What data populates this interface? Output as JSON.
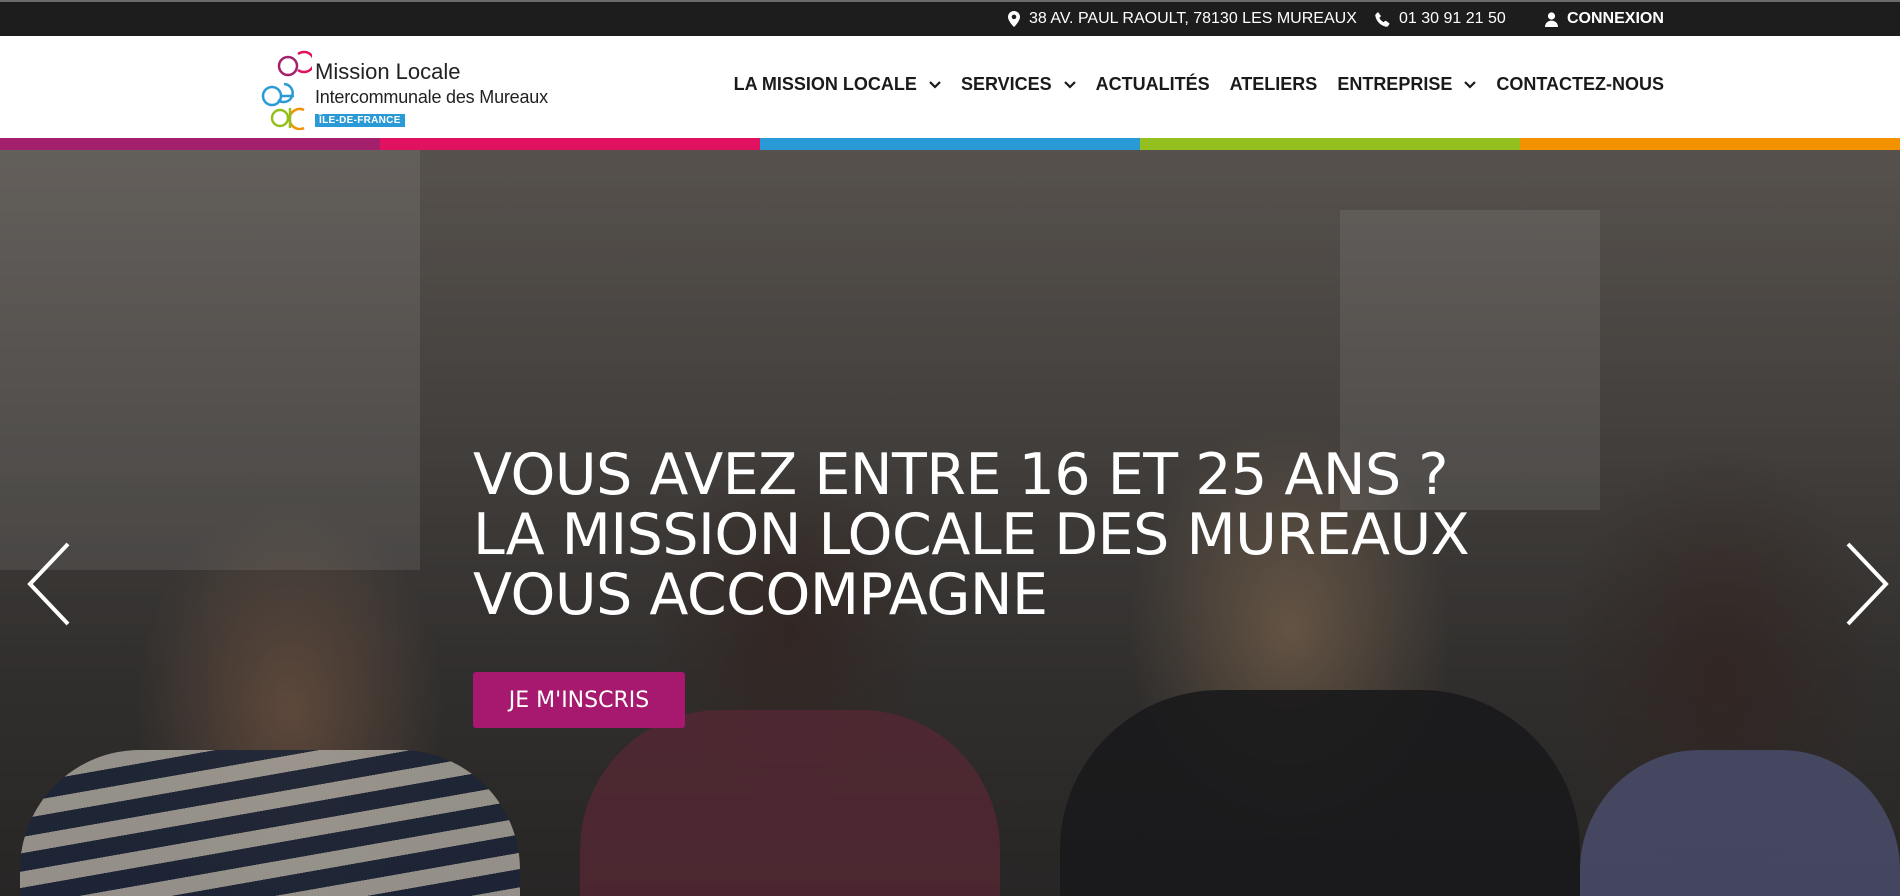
{
  "topbar": {
    "address": "38 AV. PAUL RAOULT, 78130 LES MUREAUX",
    "phone": "01 30 91 21 50",
    "login": "CONNEXION",
    "icons": [
      "location-pin-icon",
      "phone-icon",
      "user-icon"
    ]
  },
  "logo": {
    "title": "Mission Locale",
    "subtitle": "Intercommunale des Mureaux",
    "badge": "ÎLE-DE-FRANCE"
  },
  "nav": {
    "items": [
      {
        "label": "LA MISSION LOCALE",
        "has_dropdown": true
      },
      {
        "label": "SERVICES",
        "has_dropdown": true
      },
      {
        "label": "ACTUALITÉS",
        "has_dropdown": false
      },
      {
        "label": "ATELIERS",
        "has_dropdown": false
      },
      {
        "label": "ENTREPRISE",
        "has_dropdown": true
      },
      {
        "label": "CONTACTEZ-NOUS",
        "has_dropdown": false
      }
    ]
  },
  "stripe_colors": [
    "#a4206c",
    "#e0125f",
    "#2a9ad6",
    "#93c01f",
    "#f39200"
  ],
  "hero": {
    "heading_lines": [
      "VOUS AVEZ ENTRE 16 ET 25 ANS ?",
      "LA MISSION LOCALE DES MUREAUX",
      "VOUS ACCOMPAGNE"
    ],
    "cta_label": "JE M'INSCRIS",
    "cta_color": "#a6196f"
  },
  "colors": {
    "topbar_bg": "#1d1d1d",
    "accent": "#a6196f"
  }
}
